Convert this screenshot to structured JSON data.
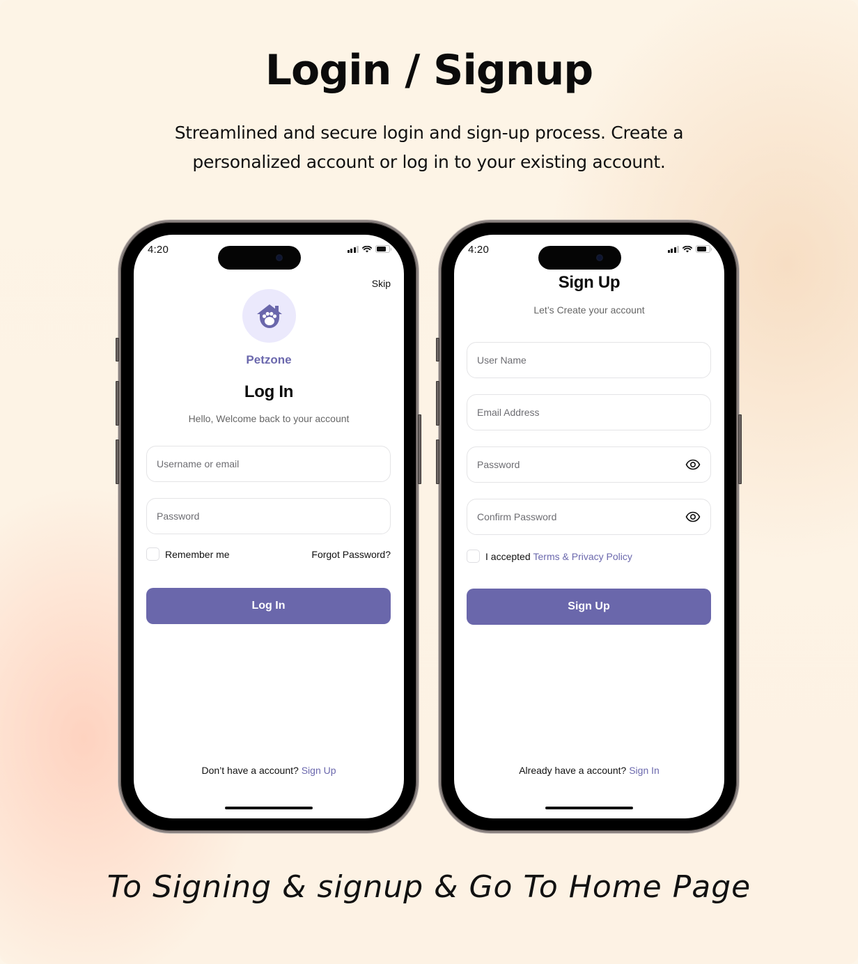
{
  "header": {
    "title": "Login / Signup",
    "subtitle_line1": "Streamlined and secure login and  sign-up process. Create a",
    "subtitle_line2": "personalized account or log  in to your existing account."
  },
  "caption": "To Signing & signup & Go To Home Page",
  "colors": {
    "accent": "#6a67ab",
    "brand_text": "#6b68ad",
    "logo_bg": "#ebe9fc",
    "background": "#fdf4e6"
  },
  "status_bar": {
    "time": "4:20",
    "icons": [
      "cellular-signal-icon",
      "wifi-icon",
      "battery-icon"
    ]
  },
  "login_screen": {
    "skip_label": "Skip",
    "logo_icon": "paw-house-icon",
    "brand_name": "Petzone",
    "title": "Log In",
    "subtitle": "Hello, Welcome back to your account",
    "fields": [
      {
        "placeholder": "Username or email",
        "value": ""
      },
      {
        "placeholder": "Password",
        "value": ""
      }
    ],
    "remember_label": "Remember me",
    "remember_checked": false,
    "forgot_label": "Forgot Password?",
    "submit_label": "Log In",
    "footer_text": "Don’t have a account?",
    "footer_link": "Sign Up"
  },
  "signup_screen": {
    "title": "Sign Up",
    "subtitle": "Let’s Create your account",
    "fields": [
      {
        "placeholder": "User Name",
        "value": ""
      },
      {
        "placeholder": "Email Address",
        "value": ""
      },
      {
        "placeholder": "Password",
        "value": "",
        "icon": "eye-icon"
      },
      {
        "placeholder": "Confirm Password",
        "value": "",
        "icon": "eye-icon"
      }
    ],
    "terms_prefix": "I accepted",
    "terms_link": "Terms & Privacy Policy",
    "terms_checked": false,
    "submit_label": "Sign Up",
    "footer_text": "Already have a account?",
    "footer_link": "Sign In"
  }
}
